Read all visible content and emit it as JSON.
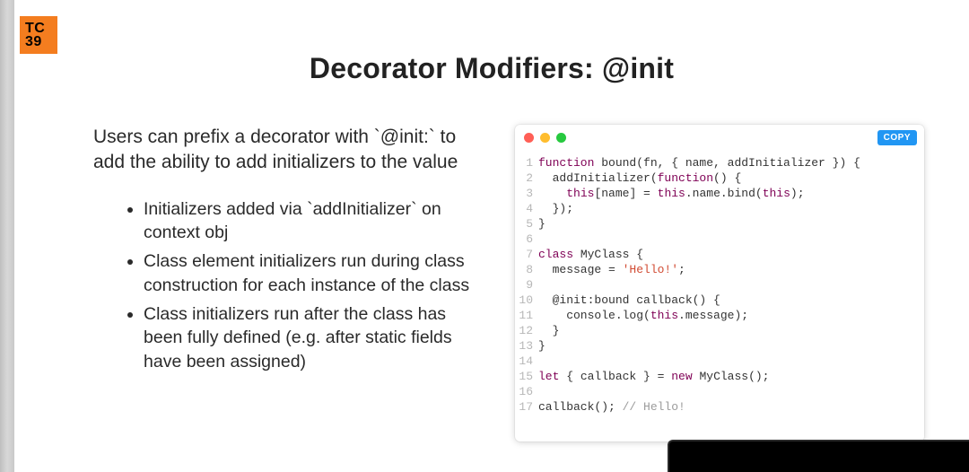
{
  "logo": {
    "line1": "TC",
    "line2": "39"
  },
  "title": "Decorator Modifiers: @init",
  "intro": "Users can prefix a decorator with `@init:` to add the ability to add initializers to the value",
  "bullets": [
    "Initializers added via `addInitializer` on context obj",
    "Class element initializers run during class construction for each instance of the class",
    "Class initializers run after the class has been fully defined (e.g. after static fields have been assigned)"
  ],
  "code": {
    "copy_label": "COPY",
    "traffic_colors": {
      "red": "#ff5f56",
      "yellow": "#ffbd2e",
      "green": "#27c93f"
    },
    "line_count": 17,
    "lines_plain": [
      "function bound(fn, { name, addInitializer }) {",
      "  addInitializer(function() {",
      "    this[name] = this.name.bind(this);",
      "  });",
      "}",
      "",
      "class MyClass {",
      "  message = 'Hello!';",
      "",
      "  @init:bound callback() {",
      "    console.log(this.message);",
      "  }",
      "}",
      "",
      "let { callback } = new MyClass();",
      "",
      "callback(); // Hello!"
    ],
    "tokens": [
      [
        {
          "t": "function ",
          "c": "kw"
        },
        {
          "t": "bound(fn, { name, addInitializer }) {",
          "c": ""
        }
      ],
      [
        {
          "t": "  addInitializer(",
          "c": ""
        },
        {
          "t": "function",
          "c": "kw"
        },
        {
          "t": "() {",
          "c": ""
        }
      ],
      [
        {
          "t": "    ",
          "c": ""
        },
        {
          "t": "this",
          "c": "kw"
        },
        {
          "t": "[name] = ",
          "c": ""
        },
        {
          "t": "this",
          "c": "kw"
        },
        {
          "t": ".name.bind(",
          "c": ""
        },
        {
          "t": "this",
          "c": "kw"
        },
        {
          "t": ");",
          "c": ""
        }
      ],
      [
        {
          "t": "  });",
          "c": ""
        }
      ],
      [
        {
          "t": "}",
          "c": ""
        }
      ],
      [
        {
          "t": "",
          "c": ""
        }
      ],
      [
        {
          "t": "class ",
          "c": "kw"
        },
        {
          "t": "MyClass {",
          "c": ""
        }
      ],
      [
        {
          "t": "  message = ",
          "c": ""
        },
        {
          "t": "'Hello!'",
          "c": "str"
        },
        {
          "t": ";",
          "c": ""
        }
      ],
      [
        {
          "t": "",
          "c": ""
        }
      ],
      [
        {
          "t": "  @init:bound callback() {",
          "c": ""
        }
      ],
      [
        {
          "t": "    console.log(",
          "c": ""
        },
        {
          "t": "this",
          "c": "kw"
        },
        {
          "t": ".message);",
          "c": ""
        }
      ],
      [
        {
          "t": "  }",
          "c": ""
        }
      ],
      [
        {
          "t": "}",
          "c": ""
        }
      ],
      [
        {
          "t": "",
          "c": ""
        }
      ],
      [
        {
          "t": "let ",
          "c": "kw"
        },
        {
          "t": "{ callback } = ",
          "c": ""
        },
        {
          "t": "new ",
          "c": "kw"
        },
        {
          "t": "MyClass();",
          "c": ""
        }
      ],
      [
        {
          "t": "",
          "c": ""
        }
      ],
      [
        {
          "t": "callback(); ",
          "c": ""
        },
        {
          "t": "// Hello!",
          "c": "cmt"
        }
      ]
    ]
  }
}
